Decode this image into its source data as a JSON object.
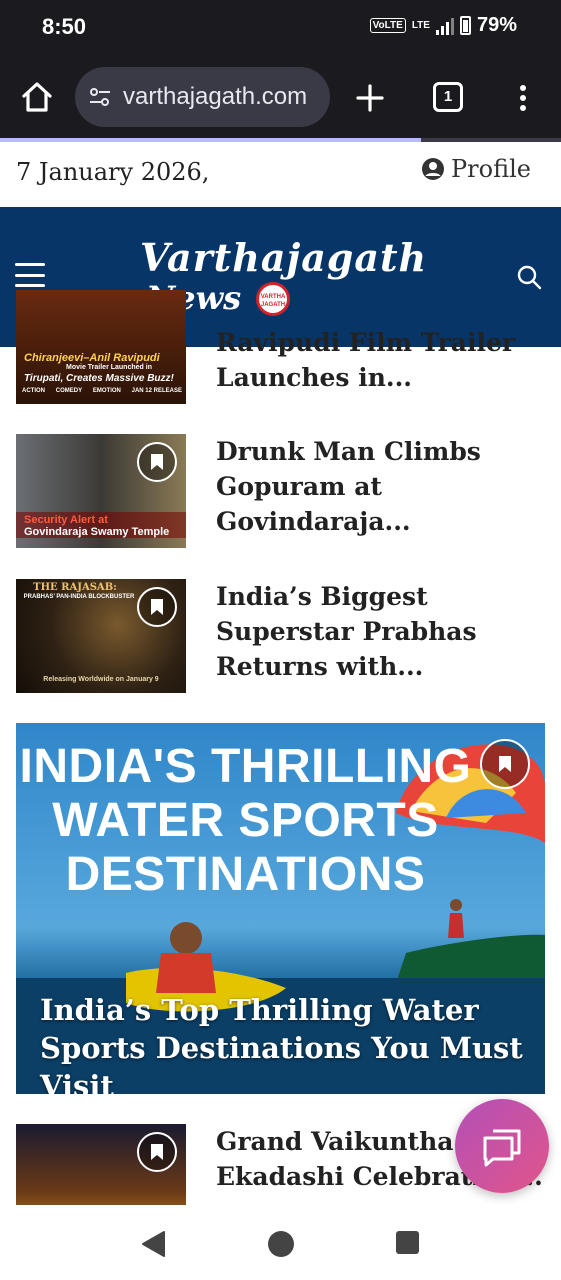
{
  "status_bar": {
    "time": "8:50",
    "volte": "VoLTE",
    "network": "LTE",
    "battery": "79%"
  },
  "browser": {
    "url": "varthajagath.com",
    "tab_count": "1",
    "load_progress_fraction": 0.75
  },
  "header": {
    "date": "7 January 2026,",
    "profile_label": "Profile",
    "logo_line1": "Varthajagath",
    "logo_line2": "News",
    "logo_badge": "VARTHA JAGATH"
  },
  "articles": [
    {
      "title": "Ravipudi Film Trailer Launches in...",
      "thumb_line1": "Chiranjeevi–Anil Ravipudi",
      "thumb_line2": "Movie Trailer Launched in",
      "thumb_line3": "Tirupati, Creates Massive Buzz!",
      "thumb_tags": [
        "ACTION",
        "COMEDY",
        "EMOTION",
        "JAN 12 RELEASE"
      ]
    },
    {
      "title": "Drunk Man Climbs Gopuram at Govindaraja...",
      "thumb_line1": "Security Alert at",
      "thumb_line2": "Govindaraja Swamy Temple"
    },
    {
      "title": "India’s Biggest Superstar Prabhas Returns with...",
      "thumb_line1": "THE RAJASAB:",
      "thumb_line2": "PRABHAS’ PAN-INDIA BLOCKBUSTER",
      "thumb_line3": "Releasing Worldwide on January 9"
    },
    {
      "title": "Grand Vaikuntha Ekadashi Celebration..."
    }
  ],
  "featured": {
    "headline_line1": "INDIA'S THRILLING",
    "headline_line2": "WATER SPORTS",
    "headline_line3": "DESTINATIONS",
    "title": "India’s Top Thrilling Water Sports Destinations You Must Visit"
  },
  "colors": {
    "header_bg": "#073567",
    "browser_bg": "#1b1b1f",
    "fab_start": "#b34fb8",
    "fab_end": "#e0568a"
  },
  "icons": [
    "home-icon",
    "tune-icon",
    "plus-icon",
    "tabs-icon",
    "more-vert-icon",
    "user-icon",
    "hamburger-icon",
    "search-icon",
    "bookmark-icon",
    "chat-icon",
    "back-icon",
    "home-circle-icon",
    "recents-icon"
  ]
}
